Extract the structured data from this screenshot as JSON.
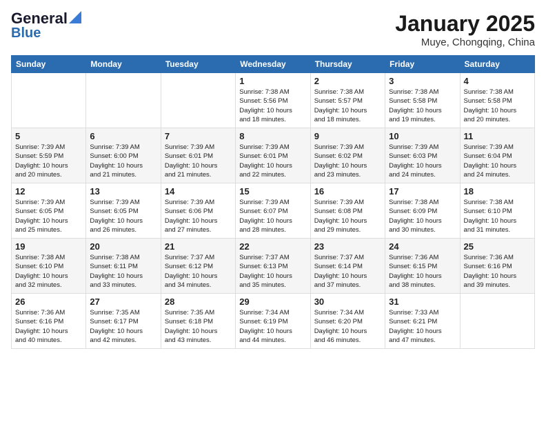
{
  "header": {
    "logo_line1": "General",
    "logo_line2": "Blue",
    "month": "January 2025",
    "location": "Muye, Chongqing, China"
  },
  "weekdays": [
    "Sunday",
    "Monday",
    "Tuesday",
    "Wednesday",
    "Thursday",
    "Friday",
    "Saturday"
  ],
  "weeks": [
    [
      {
        "day": "",
        "info": ""
      },
      {
        "day": "",
        "info": ""
      },
      {
        "day": "",
        "info": ""
      },
      {
        "day": "1",
        "info": "Sunrise: 7:38 AM\nSunset: 5:56 PM\nDaylight: 10 hours\nand 18 minutes."
      },
      {
        "day": "2",
        "info": "Sunrise: 7:38 AM\nSunset: 5:57 PM\nDaylight: 10 hours\nand 18 minutes."
      },
      {
        "day": "3",
        "info": "Sunrise: 7:38 AM\nSunset: 5:58 PM\nDaylight: 10 hours\nand 19 minutes."
      },
      {
        "day": "4",
        "info": "Sunrise: 7:38 AM\nSunset: 5:58 PM\nDaylight: 10 hours\nand 20 minutes."
      }
    ],
    [
      {
        "day": "5",
        "info": "Sunrise: 7:39 AM\nSunset: 5:59 PM\nDaylight: 10 hours\nand 20 minutes."
      },
      {
        "day": "6",
        "info": "Sunrise: 7:39 AM\nSunset: 6:00 PM\nDaylight: 10 hours\nand 21 minutes."
      },
      {
        "day": "7",
        "info": "Sunrise: 7:39 AM\nSunset: 6:01 PM\nDaylight: 10 hours\nand 21 minutes."
      },
      {
        "day": "8",
        "info": "Sunrise: 7:39 AM\nSunset: 6:01 PM\nDaylight: 10 hours\nand 22 minutes."
      },
      {
        "day": "9",
        "info": "Sunrise: 7:39 AM\nSunset: 6:02 PM\nDaylight: 10 hours\nand 23 minutes."
      },
      {
        "day": "10",
        "info": "Sunrise: 7:39 AM\nSunset: 6:03 PM\nDaylight: 10 hours\nand 24 minutes."
      },
      {
        "day": "11",
        "info": "Sunrise: 7:39 AM\nSunset: 6:04 PM\nDaylight: 10 hours\nand 24 minutes."
      }
    ],
    [
      {
        "day": "12",
        "info": "Sunrise: 7:39 AM\nSunset: 6:05 PM\nDaylight: 10 hours\nand 25 minutes."
      },
      {
        "day": "13",
        "info": "Sunrise: 7:39 AM\nSunset: 6:05 PM\nDaylight: 10 hours\nand 26 minutes."
      },
      {
        "day": "14",
        "info": "Sunrise: 7:39 AM\nSunset: 6:06 PM\nDaylight: 10 hours\nand 27 minutes."
      },
      {
        "day": "15",
        "info": "Sunrise: 7:39 AM\nSunset: 6:07 PM\nDaylight: 10 hours\nand 28 minutes."
      },
      {
        "day": "16",
        "info": "Sunrise: 7:39 AM\nSunset: 6:08 PM\nDaylight: 10 hours\nand 29 minutes."
      },
      {
        "day": "17",
        "info": "Sunrise: 7:38 AM\nSunset: 6:09 PM\nDaylight: 10 hours\nand 30 minutes."
      },
      {
        "day": "18",
        "info": "Sunrise: 7:38 AM\nSunset: 6:10 PM\nDaylight: 10 hours\nand 31 minutes."
      }
    ],
    [
      {
        "day": "19",
        "info": "Sunrise: 7:38 AM\nSunset: 6:10 PM\nDaylight: 10 hours\nand 32 minutes."
      },
      {
        "day": "20",
        "info": "Sunrise: 7:38 AM\nSunset: 6:11 PM\nDaylight: 10 hours\nand 33 minutes."
      },
      {
        "day": "21",
        "info": "Sunrise: 7:37 AM\nSunset: 6:12 PM\nDaylight: 10 hours\nand 34 minutes."
      },
      {
        "day": "22",
        "info": "Sunrise: 7:37 AM\nSunset: 6:13 PM\nDaylight: 10 hours\nand 35 minutes."
      },
      {
        "day": "23",
        "info": "Sunrise: 7:37 AM\nSunset: 6:14 PM\nDaylight: 10 hours\nand 37 minutes."
      },
      {
        "day": "24",
        "info": "Sunrise: 7:36 AM\nSunset: 6:15 PM\nDaylight: 10 hours\nand 38 minutes."
      },
      {
        "day": "25",
        "info": "Sunrise: 7:36 AM\nSunset: 6:16 PM\nDaylight: 10 hours\nand 39 minutes."
      }
    ],
    [
      {
        "day": "26",
        "info": "Sunrise: 7:36 AM\nSunset: 6:16 PM\nDaylight: 10 hours\nand 40 minutes."
      },
      {
        "day": "27",
        "info": "Sunrise: 7:35 AM\nSunset: 6:17 PM\nDaylight: 10 hours\nand 42 minutes."
      },
      {
        "day": "28",
        "info": "Sunrise: 7:35 AM\nSunset: 6:18 PM\nDaylight: 10 hours\nand 43 minutes."
      },
      {
        "day": "29",
        "info": "Sunrise: 7:34 AM\nSunset: 6:19 PM\nDaylight: 10 hours\nand 44 minutes."
      },
      {
        "day": "30",
        "info": "Sunrise: 7:34 AM\nSunset: 6:20 PM\nDaylight: 10 hours\nand 46 minutes."
      },
      {
        "day": "31",
        "info": "Sunrise: 7:33 AM\nSunset: 6:21 PM\nDaylight: 10 hours\nand 47 minutes."
      },
      {
        "day": "",
        "info": ""
      }
    ]
  ]
}
